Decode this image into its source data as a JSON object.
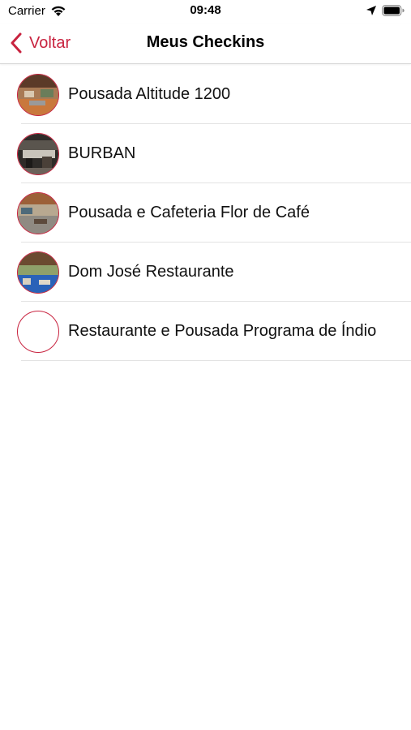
{
  "status_bar": {
    "carrier": "Carrier",
    "time": "09:48",
    "icons": [
      "wifi-icon",
      "location-arrow-icon",
      "battery-icon"
    ]
  },
  "nav": {
    "back_label": "Voltar",
    "title": "Meus Checkins",
    "accent_color": "#c8233f"
  },
  "checkins": [
    {
      "name": "Pousada Altitude 1200",
      "has_photo": true
    },
    {
      "name": "BURBAN",
      "has_photo": true
    },
    {
      "name": "Pousada e Cafeteria Flor de Café",
      "has_photo": true
    },
    {
      "name": "Dom José Restaurante",
      "has_photo": true
    },
    {
      "name": "Restaurante e Pousada Programa de Índio",
      "has_photo": false
    }
  ]
}
